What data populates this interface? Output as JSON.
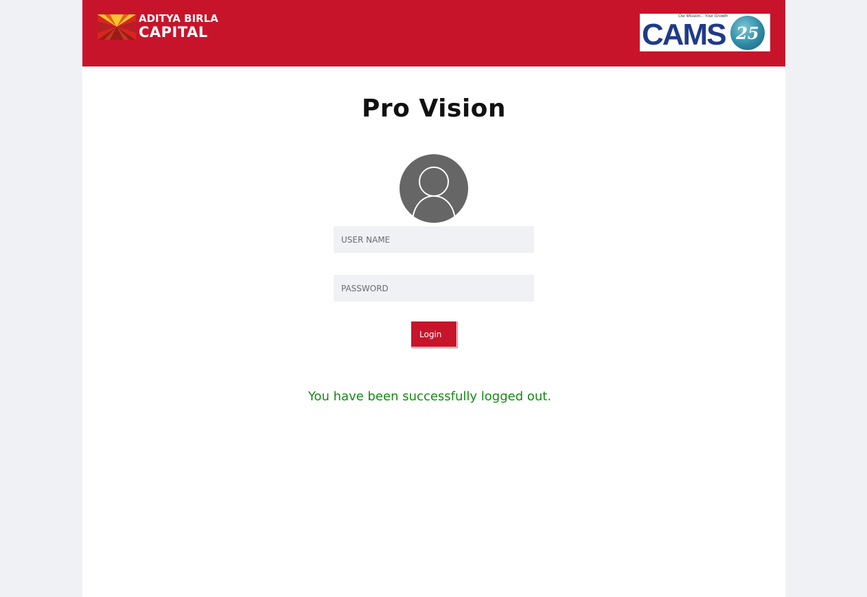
{
  "header": {
    "brand_line1": "ADITYA BIRLA",
    "brand_line2": "CAPITAL",
    "partner_tagline": "Our Mission... Your Growth",
    "partner_name": "CAMS",
    "partner_badge": "25",
    "background_color": "#c8142b"
  },
  "main": {
    "title": "Pro Vision",
    "avatar_icon": "user-avatar-icon",
    "username": {
      "placeholder": "USER NAME",
      "value": ""
    },
    "password": {
      "placeholder": "PASSWORD",
      "value": ""
    },
    "login_label": "Login",
    "status_message": "You have been successfully logged out.",
    "status_color": "#128a12"
  }
}
